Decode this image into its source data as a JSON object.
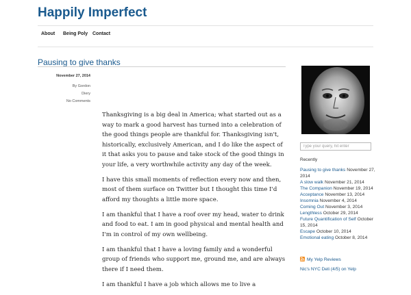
{
  "site": {
    "title": "Happily Imperfect"
  },
  "nav": {
    "items": [
      "About",
      "Being Poly",
      "Contact"
    ]
  },
  "post": {
    "title": "Pausing to give thanks",
    "date": "November 27, 2014",
    "author_prefix": "By",
    "author_first": "Gordon",
    "author_last": "Diery",
    "comments": "No Comments",
    "paragraphs": [
      "Thanksgiving is a big deal in America; what started out as a way to mark a good harvest has turned into a celebration of the good things people are thankful for. Thanksgiving isn't, historically, exclusively American, and I do like the aspect of it that asks you to pause and take stock of the good things in your life, a very worthwhile activity any day of the week.",
      "I have this small moments of reflection every now and then, most of them surface on Twitter but I thought this time I'd afford my thoughts a little more space.",
      "I am thankful that I have a roof over my head, water to drink and food to eat. I am in good physical and mental health and I'm in control of my own wellbeing.",
      "I am thankful that I have a loving family and a wonderful group of friends who support me, ground me, and are always there if I need them.",
      "I am thankful I have a job which allows me to live a"
    ]
  },
  "sidebar": {
    "search_placeholder": "Type your query, hit enter",
    "recent_heading": "Recently",
    "recent": [
      {
        "title": "Pausing to give thanks",
        "date": "November 27, 2014"
      },
      {
        "title": "A slow walk",
        "date": "November 21, 2014"
      },
      {
        "title": "The Companion",
        "date": "November 19, 2014"
      },
      {
        "title": "Acceptance",
        "date": "November 13, 2014"
      },
      {
        "title": "Insomnia",
        "date": "November 4, 2014"
      },
      {
        "title": "Coming Out",
        "date": "November 3, 2014"
      },
      {
        "title": "Lengthless",
        "date": "October 29, 2014"
      },
      {
        "title": "Future Quantification of Self",
        "date": "October 15, 2014"
      },
      {
        "title": "Escape",
        "date": "October 10, 2014"
      },
      {
        "title": "Emotional eating",
        "date": "October 8, 2014"
      }
    ],
    "yelp_title": "My Yelp Reviews",
    "yelp_first_entry": "Nic's NYC Deli (4/5) on Yelp"
  },
  "colors": {
    "link": "#1a5a8e",
    "rss": "#f28a1a",
    "text": "#222222"
  },
  "icons": {
    "feed": "rss-icon",
    "profile": "avatar"
  }
}
